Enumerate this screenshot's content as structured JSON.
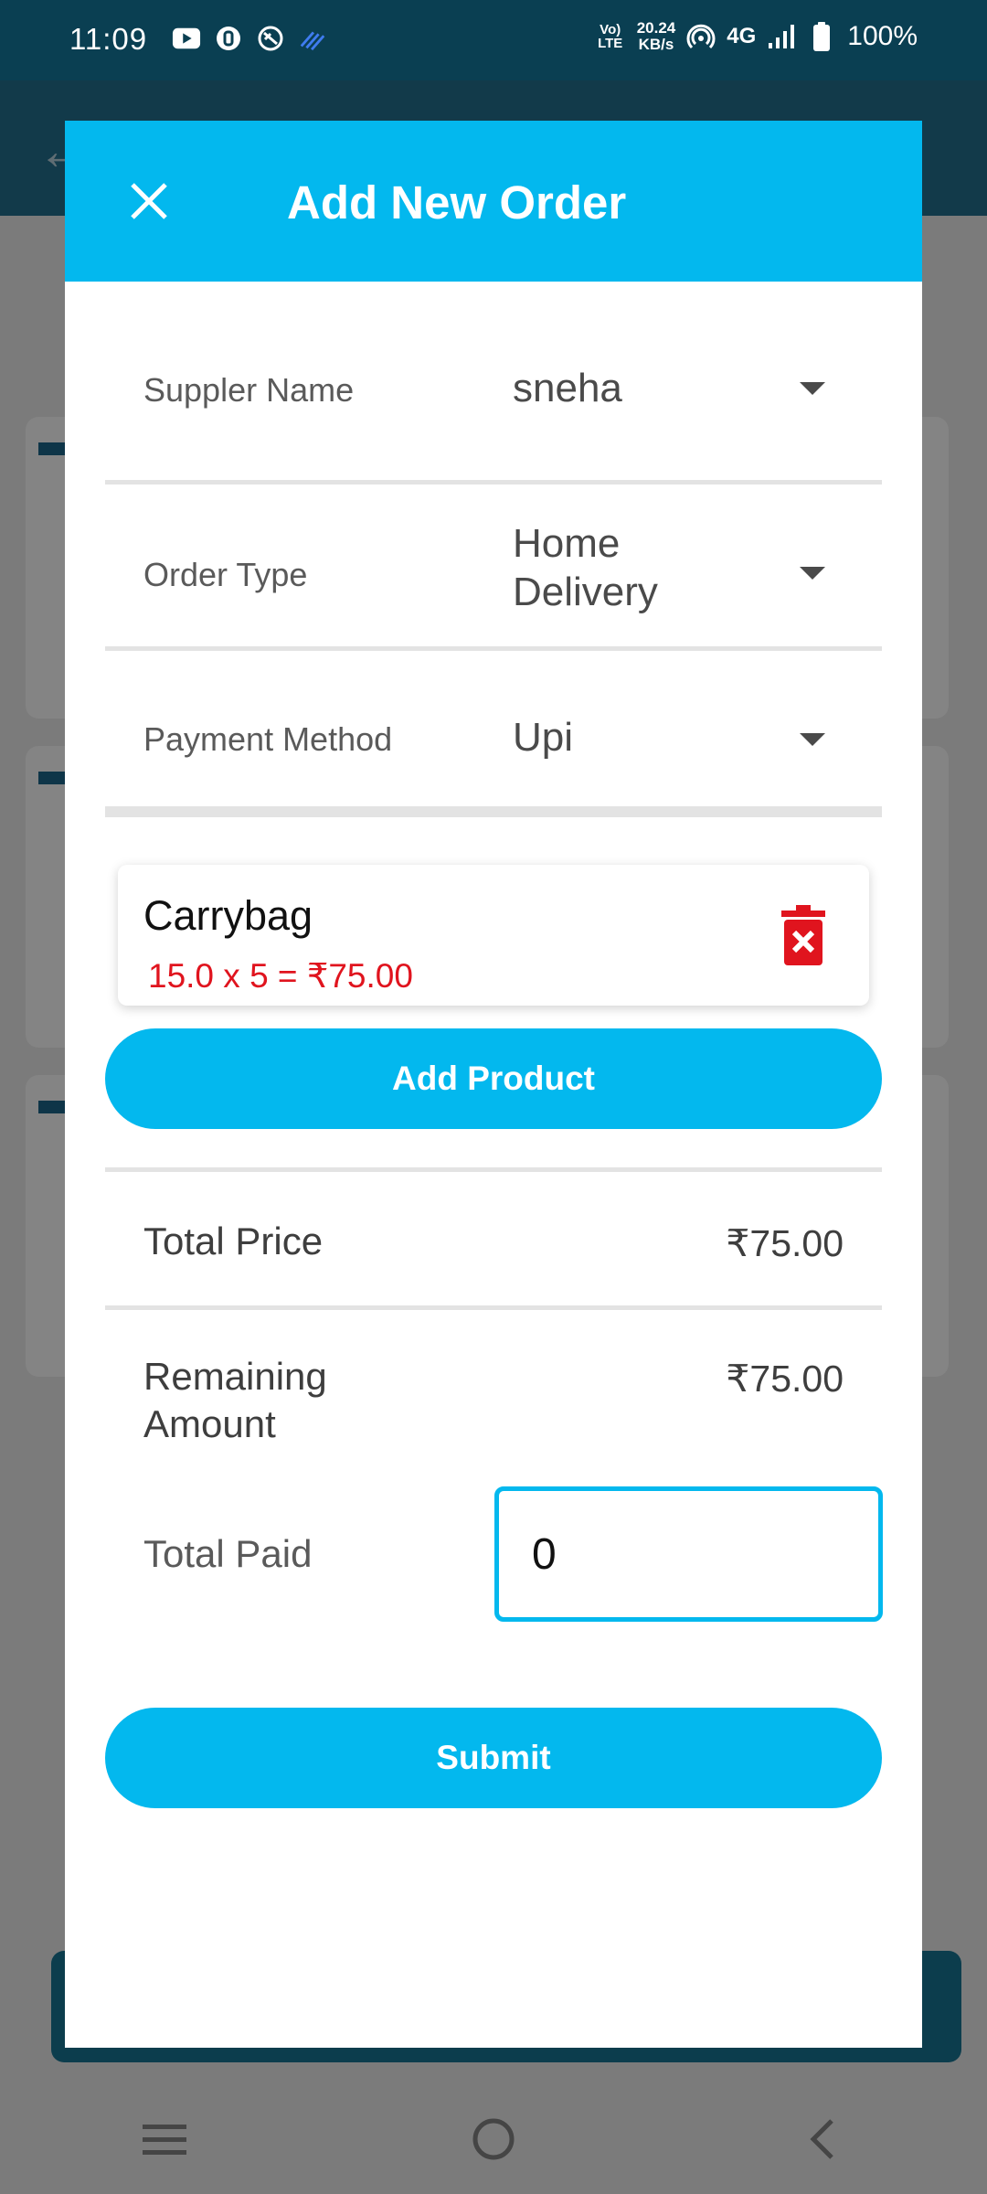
{
  "status_bar": {
    "time": "11:09",
    "network_small": "Vo) LTE",
    "speed_value": "20.24",
    "speed_unit": "KB/s",
    "network_type": "4G",
    "battery": "100%"
  },
  "dialog": {
    "title": "Add New Order",
    "fields": {
      "supplier": {
        "label": "Suppler Name",
        "value": "sneha"
      },
      "order_type": {
        "label": "Order Type",
        "value_line1": "Home",
        "value_line2": "Delivery"
      },
      "payment": {
        "label": "Payment Method",
        "value": "Upi"
      }
    },
    "product": {
      "name": "Carrybag",
      "calc": "15.0 x 5 = ₹75.00"
    },
    "add_product_label": "Add Product",
    "total_price": {
      "label": "Total Price",
      "value": "₹75.00"
    },
    "remaining": {
      "label_line1": "Remaining",
      "label_line2": "Amount",
      "value": "₹75.00"
    },
    "total_paid": {
      "label": "Total Paid",
      "value": "0"
    },
    "submit_label": "Submit"
  },
  "colors": {
    "accent": "#03b8ee",
    "status_bar": "#0a3f52",
    "delete": "#e0141e"
  }
}
